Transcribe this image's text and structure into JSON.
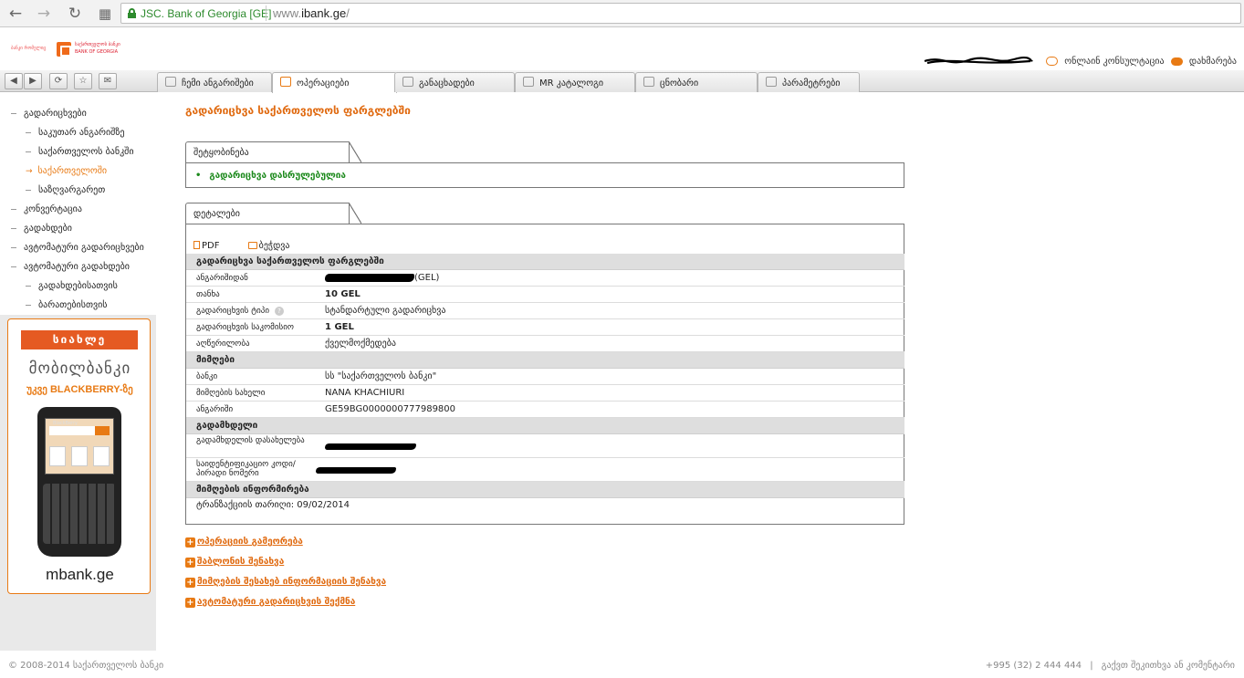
{
  "browser": {
    "org": "JSC. Bank of Georgia [GE]",
    "url_prefix": "www.",
    "url_domain": "ibank.ge",
    "url_suffix": "/",
    "back": "←",
    "forward": "→",
    "reload": "↻",
    "apps": "▦"
  },
  "header": {
    "logo_line1": "ბანკი რომელიც",
    "logo_line2": "საქართველოს ბანკი",
    "logo_line3": "BANK OF GEORGIA",
    "online_consult": "ონლაინ კონსულტაცია",
    "help": "დახმარება"
  },
  "tabbar": {
    "back": "◀",
    "forward": "▶",
    "refresh": "⟳",
    "star": "☆",
    "mail": "✉",
    "tabs": [
      {
        "label": "ჩემი ანგარიშები",
        "icon": "accounts-icon"
      },
      {
        "label": "ოპერაციები",
        "icon": "operations-icon"
      },
      {
        "label": "განაცხადები",
        "icon": "applications-icon"
      },
      {
        "label": "MR კატალოგი",
        "icon": "catalog-icon"
      },
      {
        "label": "ცნობარი",
        "icon": "directory-icon"
      },
      {
        "label": "პარამეტრები",
        "icon": "gear-icon"
      }
    ]
  },
  "sidebar": {
    "items": [
      {
        "label": "გადარიცხვები"
      },
      {
        "label": "საკუთარ ანგარიშზე"
      },
      {
        "label": "საქართველოს ბანკში"
      },
      {
        "label": "საქართველოში"
      },
      {
        "label": "საზღვარგარეთ"
      },
      {
        "label": "კონვერტაცია"
      },
      {
        "label": "გადახდები"
      },
      {
        "label": "ავტომატური გადარიცხვები"
      },
      {
        "label": "ავტომატური გადახდები"
      },
      {
        "label": "გადახდებისათვის"
      },
      {
        "label": "ბარათებისთვის"
      }
    ],
    "promo": {
      "badge": "სიახლე",
      "title": "მობილბანკი",
      "subtitle": "უკვე BLACKBERRY-ზე",
      "phone_brand": "BlackBerry",
      "site": "mbank.ge"
    }
  },
  "main": {
    "title": "გადარიცხვა საქართველოს ფარგლებში",
    "notice": {
      "tab": "შეტყობინება",
      "message": "გადარიცხვა დასრულებულია"
    },
    "details": {
      "tab": "დეტალები",
      "pdf": "PDF",
      "print": "ბეჭდვა",
      "section1": "გადარიცხვა საქართველოს ფარგლებში",
      "from_account_label": "ანგარიშიდან",
      "from_account_suffix": "(GEL)",
      "amount_label": "თანხა",
      "amount": "10 GEL",
      "type_label": "გადარიცხვის ტიპი",
      "type_help": "?",
      "type": "სტანდარტული გადარიცხვა",
      "fee_label": "გადარიცხვის საკომისიო",
      "fee": "1 GEL",
      "description_label": "აღწერილობა",
      "description": "ქველმოქმედება",
      "section2": "მიმღები",
      "bank_label": "ბანკი",
      "bank": "სს \"საქართველოს ბანკი\"",
      "recipient_label": "მიმღების სახელი",
      "recipient": "NANA KHACHIURI",
      "account_label": "ანგარიში",
      "account": "GE59BG0000000777989800",
      "section3": "გადამხდელი",
      "payer_name_label": "გადამხდელის დასახელება",
      "payer_id_label": "საიდენტიფიკაციო კოდი/პირადი ნომერი",
      "section4": "მიმღების ინფორმირება",
      "date_label": "ტრანზაქციის თარიღი:",
      "date": "09/02/2014"
    },
    "actions": [
      {
        "label": "ოპერაციის გამეორება"
      },
      {
        "label": "შაბლონის შენახვა"
      },
      {
        "label": "მიმღების შესახებ ინფორმაციის შენახვა"
      },
      {
        "label": "ავტომატური გადარიცხვის შექმნა"
      }
    ],
    "plus": "+"
  },
  "footer": {
    "copyright": "© 2008-2014 საქართველოს ბანკი",
    "phone": "+995 (32) 2 444 444",
    "divider": "|",
    "feedback": "გაქვთ შეკითხვა ან კომენტარი"
  },
  "colors": {
    "accent": "#e87a14",
    "title": "#e06a10",
    "success": "#1d8a1d",
    "secure": "#2d8a2d"
  }
}
